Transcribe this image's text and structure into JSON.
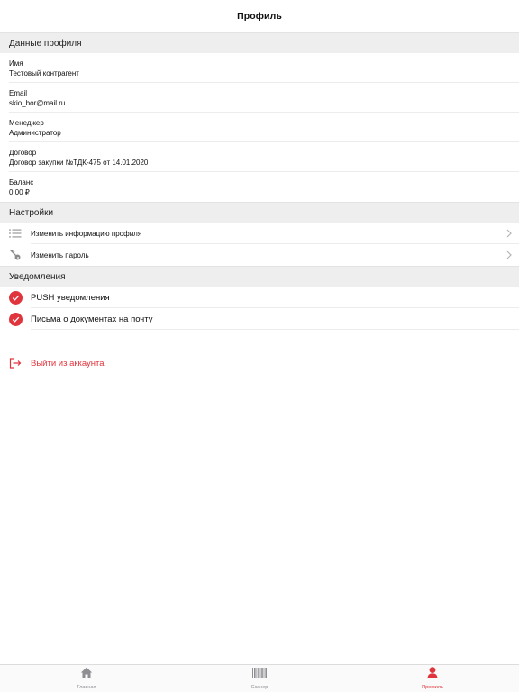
{
  "header": {
    "title": "Профиль"
  },
  "profile": {
    "section_title": "Данные профиля",
    "fields": [
      {
        "label": "Имя",
        "value": "Тестовый контрагент"
      },
      {
        "label": "Email",
        "value": "skio_bor@mail.ru"
      },
      {
        "label": "Менеджер",
        "value": "Администратор"
      },
      {
        "label": "Договор",
        "value": "Договор закупки №ТДК-475 от 14.01.2020"
      },
      {
        "label": "Баланс",
        "value": "0,00 ₽"
      }
    ]
  },
  "settings": {
    "section_title": "Настройки",
    "items": [
      {
        "label": "Изменить информацию профиля",
        "icon": "list-icon"
      },
      {
        "label": "Изменить пароль",
        "icon": "key-icon"
      }
    ]
  },
  "notifications": {
    "section_title": "Уведомления",
    "items": [
      {
        "label": "PUSH уведомления",
        "checked": true
      },
      {
        "label": "Письма о документах на почту",
        "checked": true
      }
    ]
  },
  "logout": {
    "label": "Выйти из аккаунта"
  },
  "tabbar": {
    "tabs": [
      {
        "label": "Главная",
        "icon": "home-icon",
        "active": false
      },
      {
        "label": "Сканер",
        "icon": "barcode-icon",
        "active": false
      },
      {
        "label": "Профиль",
        "icon": "person-icon",
        "active": true
      }
    ]
  },
  "colors": {
    "accent": "#e0353d",
    "section_bg": "#eeeeee",
    "separator": "#ececec",
    "inactive_tab": "#8e8e93"
  }
}
